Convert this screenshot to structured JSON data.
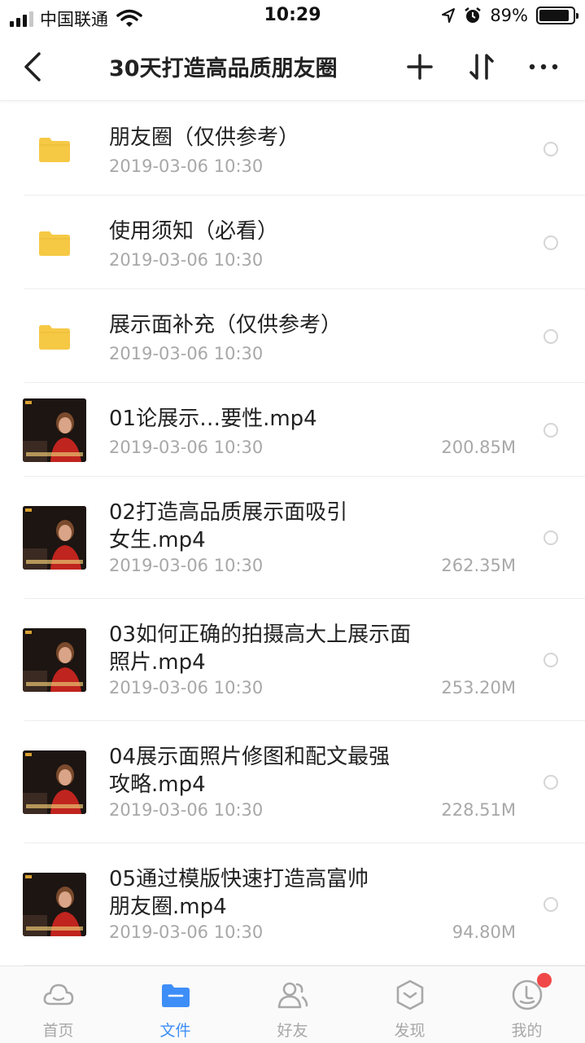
{
  "status_bar": {
    "carrier": "中国联通",
    "time": "10:29",
    "battery_percent": "89%",
    "battery_level": 0.89
  },
  "nav": {
    "title": "30天打造高品质朋友圈",
    "icons": [
      "back-icon",
      "add-icon",
      "sort-icon",
      "more-icon"
    ]
  },
  "files": [
    {
      "type": "folder",
      "name": "朋友圈（仅供参考）",
      "date": "2019-03-06 10:30",
      "size": ""
    },
    {
      "type": "folder",
      "name": "使用须知（必看）",
      "date": "2019-03-06 10:30",
      "size": ""
    },
    {
      "type": "folder",
      "name": "展示面补充（仅供参考）",
      "date": "2019-03-06 10:30",
      "size": ""
    },
    {
      "type": "video",
      "name": "01论展示…要性.mp4",
      "date": "2019-03-06 10:30",
      "size": "200.85M"
    },
    {
      "type": "video",
      "name": "02打造高品质展示面吸引\n女生.mp4",
      "date": "2019-03-06 10:30",
      "size": "262.35M"
    },
    {
      "type": "video",
      "name": "03如何正确的拍摄高大上展示面\n照片.mp4",
      "date": "2019-03-06 10:30",
      "size": "253.20M"
    },
    {
      "type": "video",
      "name": "04展示面照片修图和配文最强\n攻略.mp4",
      "date": "2019-03-06 10:30",
      "size": "228.51M"
    },
    {
      "type": "video",
      "name": "05通过模版快速打造高富帅\n朋友圈.mp4",
      "date": "2019-03-06 10:30",
      "size": "94.80M"
    }
  ],
  "tabs": [
    {
      "label": "首页",
      "icon": "cloud-icon"
    },
    {
      "label": "文件",
      "icon": "folder-icon"
    },
    {
      "label": "好友",
      "icon": "friends-icon"
    },
    {
      "label": "发现",
      "icon": "discover-icon"
    },
    {
      "label": "我的",
      "icon": "profile-icon"
    }
  ],
  "colors": {
    "accent": "#3e8ef7",
    "folder": "#f6c945",
    "badge": "#f04848"
  }
}
